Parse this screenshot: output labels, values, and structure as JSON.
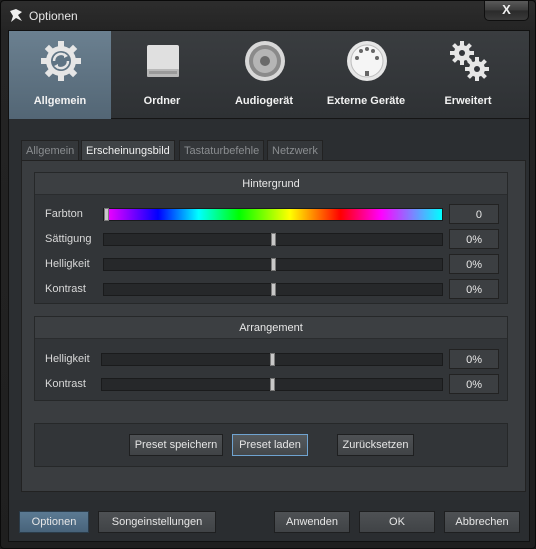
{
  "window": {
    "title": "Optionen",
    "close_label": "X"
  },
  "categories": [
    {
      "label": "Allgemein",
      "icon": "refresh-gear-icon",
      "active": true
    },
    {
      "label": "Ordner",
      "icon": "drive-icon",
      "active": false
    },
    {
      "label": "Audiogerät",
      "icon": "speaker-icon",
      "active": false
    },
    {
      "label": "Externe Geräte",
      "icon": "midi-connector-icon",
      "active": false
    },
    {
      "label": "Erweitert",
      "icon": "gears-icon",
      "active": false
    }
  ],
  "tabs": [
    {
      "label": "Allgemein",
      "active": false
    },
    {
      "label": "Erscheinungsbild",
      "active": true
    },
    {
      "label": "Tastaturbefehle",
      "active": false
    },
    {
      "label": "Netzwerk",
      "active": false
    }
  ],
  "background_group": {
    "title": "Hintergrund",
    "rows": [
      {
        "label": "Farbton",
        "value": "0",
        "level": 0.0,
        "type": "hue"
      },
      {
        "label": "Sättigung",
        "value": "0%",
        "level": 0.5,
        "type": "plain"
      },
      {
        "label": "Helligkeit",
        "value": "0%",
        "level": 0.5,
        "type": "plain"
      },
      {
        "label": "Kontrast",
        "value": "0%",
        "level": 0.5,
        "type": "plain"
      }
    ]
  },
  "arrangement_group": {
    "title": "Arrangement",
    "rows": [
      {
        "label": "Helligkeit",
        "value": "0%",
        "level": 0.5
      },
      {
        "label": "Kontrast",
        "value": "0%",
        "level": 0.5
      }
    ]
  },
  "preset_buttons": {
    "save": "Preset speichern",
    "load": "Preset laden",
    "reset": "Zurücksetzen"
  },
  "footer": {
    "options": "Optionen",
    "song_settings": "Songeinstellungen",
    "apply": "Anwenden",
    "ok": "OK",
    "cancel": "Abbrechen"
  },
  "colors": {
    "accent": "#536675",
    "focus": "#6fa3d0",
    "background": "#2b2e31"
  }
}
